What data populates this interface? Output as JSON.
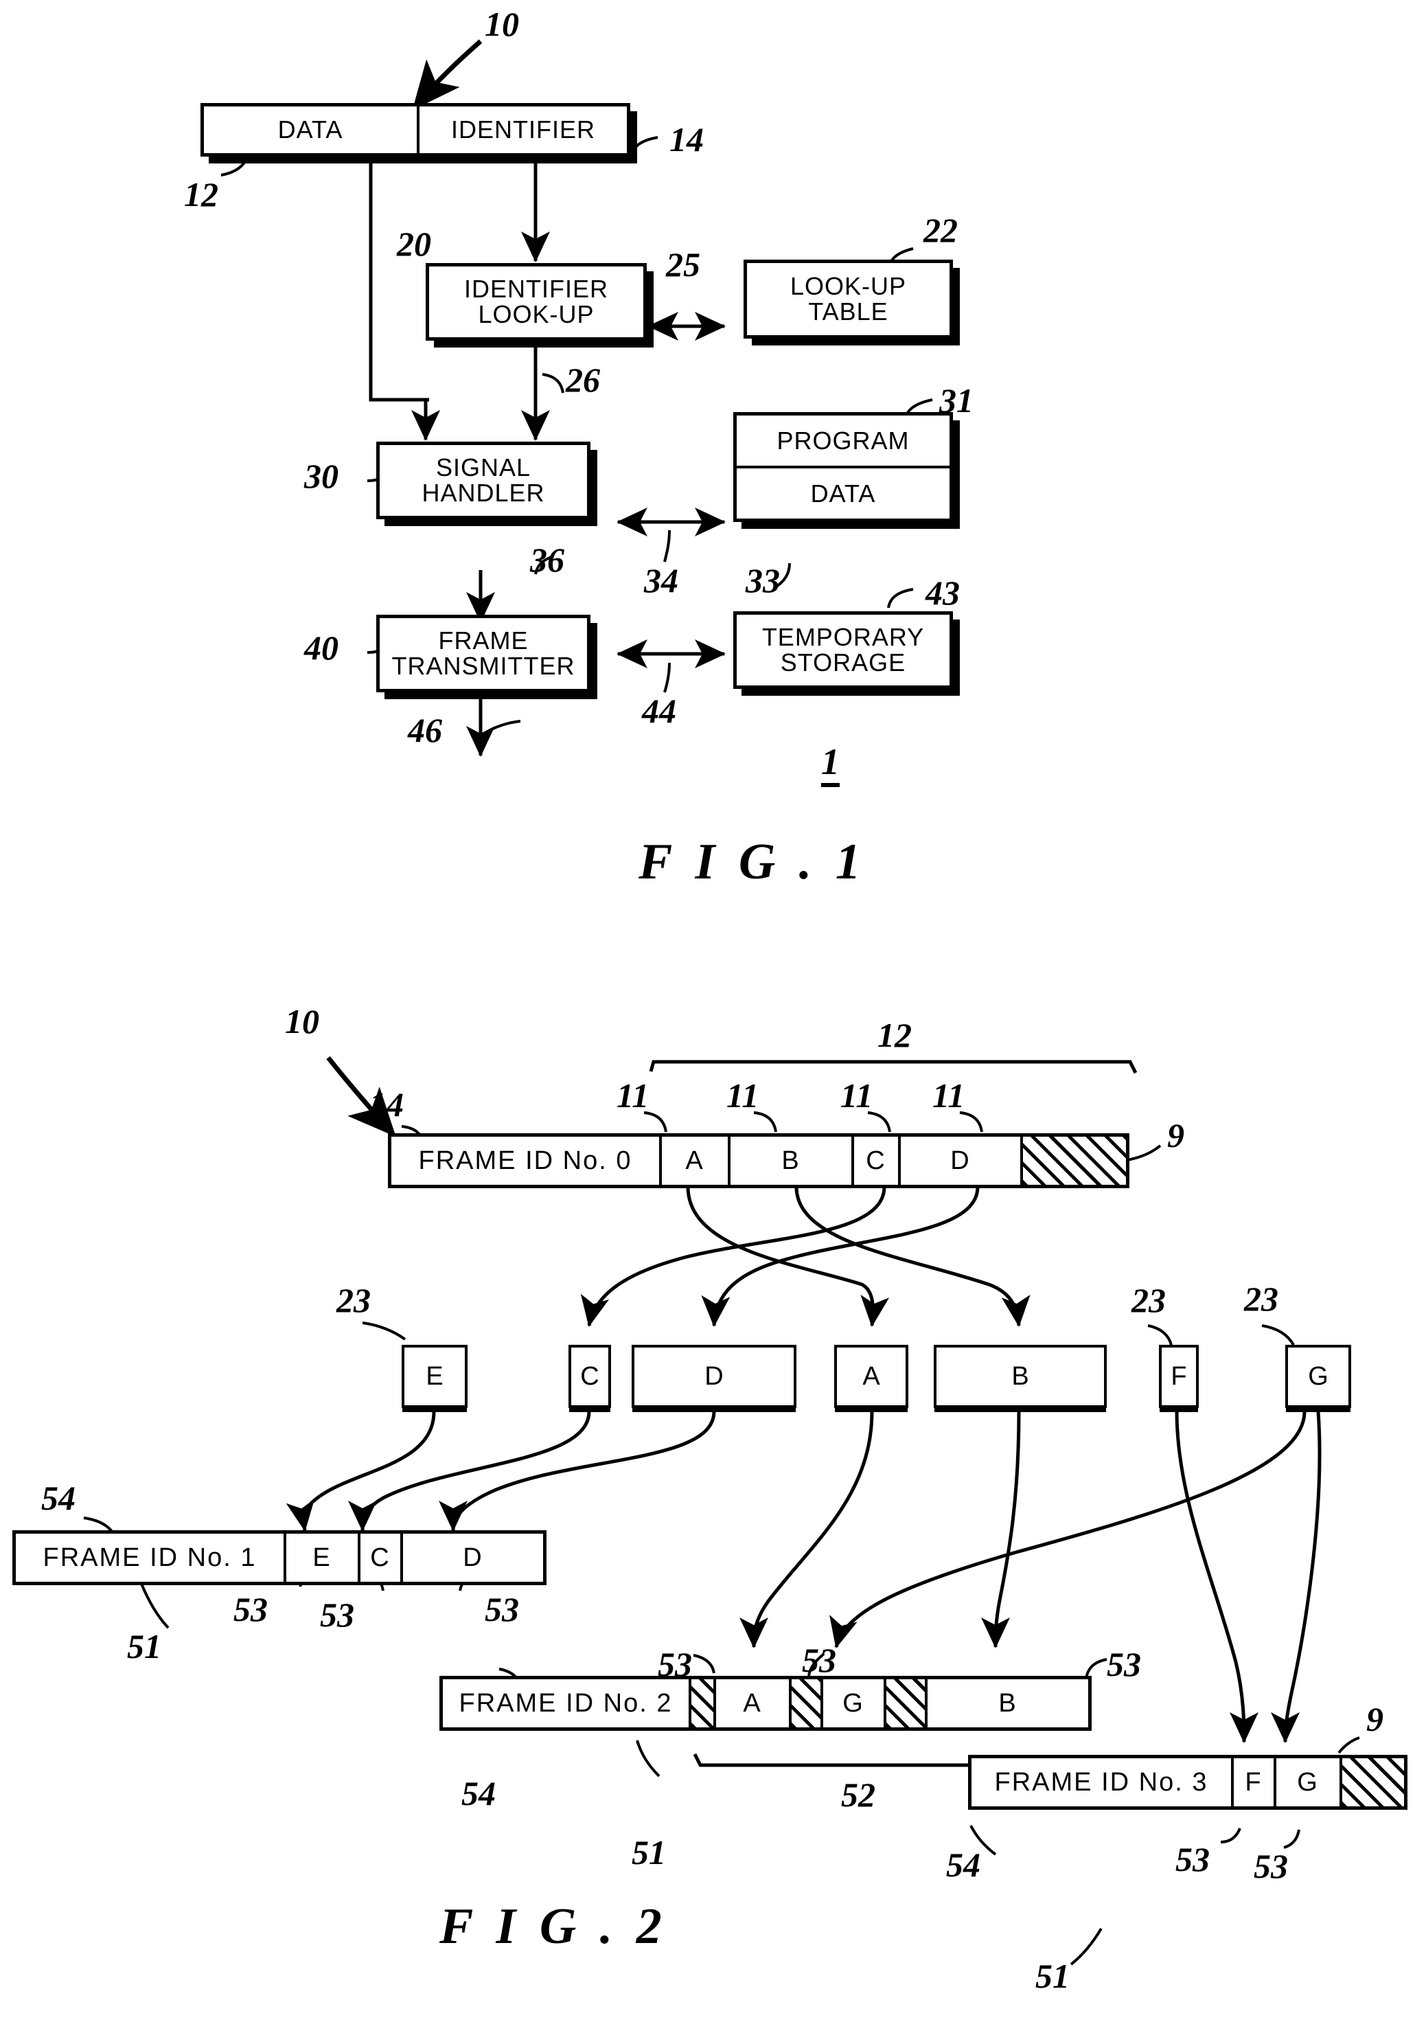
{
  "document": {
    "type": "patent-drawing-sheet",
    "figures": [
      "FIG. 1",
      "FIG. 2"
    ]
  },
  "fig1": {
    "caption": "F I G .   1",
    "system_number": "1",
    "packet": {
      "data_label": "DATA",
      "identifier_label": "IDENTIFIER",
      "data_ref": "12",
      "identifier_ref": "14",
      "system_ref": "10"
    },
    "blocks": [
      {
        "id": "identifier-lookup",
        "lines": [
          "IDENTIFIER",
          "LOOK-UP"
        ],
        "ref": "20"
      },
      {
        "id": "lookup-table",
        "lines": [
          "LOOK-UP",
          "TABLE"
        ],
        "ref": "22"
      },
      {
        "id": "signal-handler",
        "lines": [
          "SIGNAL",
          "HANDLER"
        ],
        "ref": "30"
      },
      {
        "id": "program-data",
        "lines": [
          "PROGRAM",
          "DATA"
        ],
        "ref": "31",
        "ref2": "33"
      },
      {
        "id": "frame-transmitter",
        "lines": [
          "FRAME",
          "TRANSMITTER"
        ],
        "ref": "40"
      },
      {
        "id": "temporary-storage",
        "lines": [
          "TEMPORARY",
          "STORAGE"
        ],
        "ref": "43"
      }
    ],
    "connector_refs": {
      "lookup_to_table": "25",
      "lookup_to_handler": "26",
      "handler_to_program": "34",
      "handler_to_transmitter": "36",
      "transmitter_to_storage": "44",
      "transmitter_out": "46"
    }
  },
  "fig2": {
    "caption": "F I G .   2",
    "refs": {
      "incoming_frame": "10",
      "frame_id_field": "14",
      "payload_bracket": "12",
      "segment": "11",
      "padding": "9",
      "queue_item": "23",
      "output_frame": "51",
      "output_field": "53",
      "output_id_field": "54",
      "output_bracket": "52"
    },
    "input_frame": {
      "id_label": "FRAME ID No. 0",
      "cells": [
        {
          "label": "A",
          "kind": "data"
        },
        {
          "label": "B",
          "kind": "data"
        },
        {
          "label": "C",
          "kind": "data"
        },
        {
          "label": "D",
          "kind": "data"
        },
        {
          "label": "",
          "kind": "hatch"
        }
      ],
      "segment_refs": [
        "11",
        "11",
        "11",
        "11"
      ],
      "bracket_ref": "12",
      "hatch_ref": "9"
    },
    "queue": [
      {
        "label": "E",
        "ref": "23"
      },
      {
        "label": "C",
        "ref": ""
      },
      {
        "label": "D",
        "ref": ""
      },
      {
        "label": "A",
        "ref": ""
      },
      {
        "label": "B",
        "ref": ""
      },
      {
        "label": "F",
        "ref": "23"
      },
      {
        "label": "G",
        "ref": "23"
      }
    ],
    "output_frames": [
      {
        "id_label": "FRAME ID No. 1",
        "cells": [
          {
            "label": "E",
            "kind": "data"
          },
          {
            "label": "C",
            "kind": "data"
          },
          {
            "label": "D",
            "kind": "data"
          }
        ],
        "field_refs": [
          "53",
          "53",
          "53"
        ],
        "id_ref": "54",
        "frame_ref": "51"
      },
      {
        "id_label": "FRAME ID No. 2",
        "cells": [
          {
            "label": "",
            "kind": "hatch"
          },
          {
            "label": "A",
            "kind": "data"
          },
          {
            "label": "",
            "kind": "hatch"
          },
          {
            "label": "G",
            "kind": "data"
          },
          {
            "label": "",
            "kind": "hatch"
          },
          {
            "label": "B",
            "kind": "data"
          }
        ],
        "field_refs": [
          "53",
          "53",
          "53"
        ],
        "id_ref": "54",
        "frame_ref": "51",
        "bracket_ref": "52"
      },
      {
        "id_label": "FRAME ID No. 3",
        "cells": [
          {
            "label": "F",
            "kind": "data"
          },
          {
            "label": "G",
            "kind": "data"
          },
          {
            "label": "",
            "kind": "hatch"
          }
        ],
        "field_refs": [
          "53",
          "53"
        ],
        "id_ref": "54",
        "frame_ref": "51",
        "hatch_ref": "9"
      }
    ]
  }
}
